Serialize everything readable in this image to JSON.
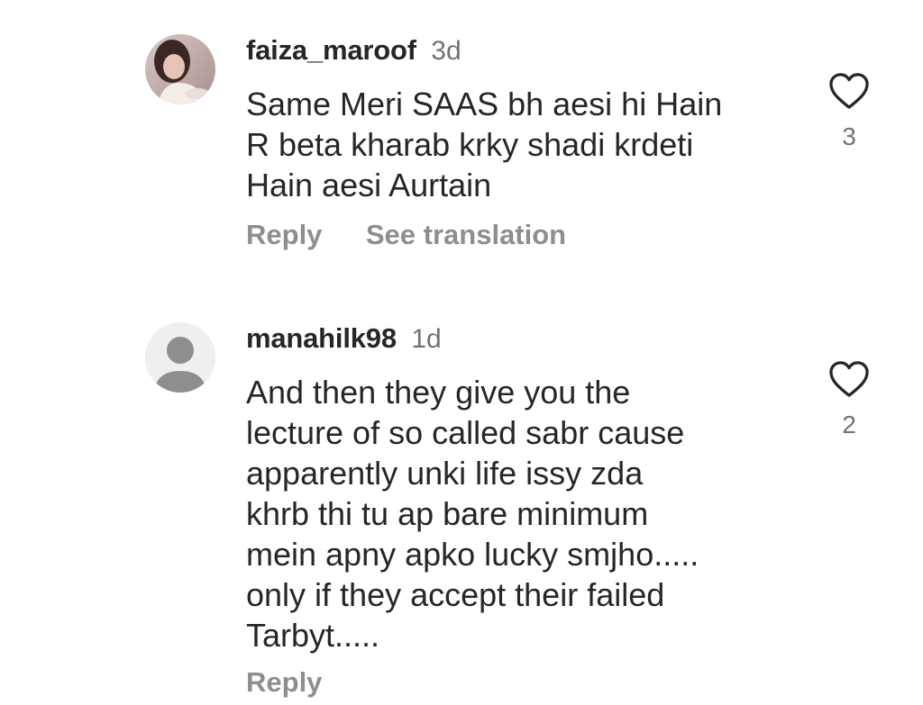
{
  "comments": [
    {
      "username": "faiza_maroof",
      "timestamp": "3d",
      "avatar": "profile-photo",
      "lines": [
        "Same Meri SAAS bh aesi hi Hain",
        "R beta kharab krky shadi krdeti",
        "Hain aesi Aurtain"
      ],
      "actions": {
        "reply": "Reply",
        "translate": "See translation"
      },
      "like_icon": "heart-outline-icon",
      "like_count": "3"
    },
    {
      "username": "manahilk98",
      "timestamp": "1d",
      "avatar": "default-avatar",
      "lines": [
        "And then they give you the",
        "lecture of so called sabr cause",
        "apparently unki life issy zda",
        "khrb thi tu ap bare minimum",
        "mein apny apko lucky smjho.....",
        "only if they accept their failed",
        "Tarbyt....."
      ],
      "actions": {
        "reply": "Reply"
      },
      "like_icon": "heart-outline-icon",
      "like_count": "2"
    }
  ],
  "colors": {
    "text": "#262626",
    "secondary": "#737373",
    "action": "#8e8e8e",
    "default_avatar_bg": "#efefef",
    "default_avatar_fg": "#8e8e8e"
  }
}
